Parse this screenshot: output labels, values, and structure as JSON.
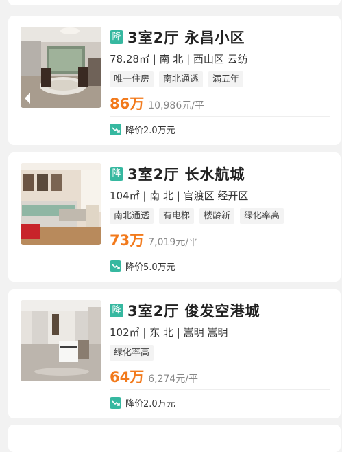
{
  "listings": [
    {
      "badge": "降",
      "title": "3室2厅 永昌小区",
      "meta": "78.28㎡ | 南 北 | 西山区 云纺",
      "tags": [
        "唯一住房",
        "南北通透",
        "满五年"
      ],
      "price": "86万",
      "unit_price": "10,986元/平",
      "price_drop": "降价2.0万元"
    },
    {
      "badge": "降",
      "title": "3室2厅 长水航城",
      "meta": "104㎡ | 南 北 | 官渡区 经开区",
      "tags": [
        "南北通透",
        "有电梯",
        "楼龄新",
        "绿化率高"
      ],
      "price": "73万",
      "unit_price": "7,019元/平",
      "price_drop": "降价5.0万元"
    },
    {
      "badge": "降",
      "title": "3室2厅 俊发空港城",
      "meta": "102㎡ | 东 北 | 嵩明 嵩明",
      "tags": [
        "绿化率高"
      ],
      "price": "64万",
      "unit_price": "6,274元/平",
      "price_drop": "降价2.0万元"
    }
  ],
  "colors": {
    "accent": "#36b8a0",
    "price": "#f27a1c",
    "background": "#f2f2f2"
  },
  "icons": {
    "badge": "price-drop-badge",
    "drop": "trend-down-icon"
  }
}
